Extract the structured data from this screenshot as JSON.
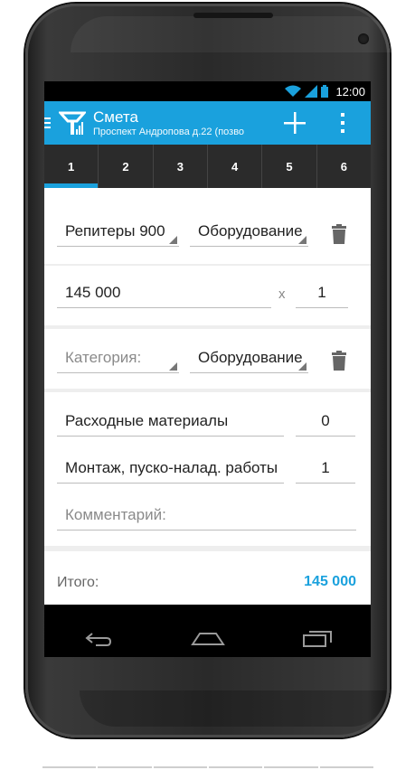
{
  "status_bar": {
    "time": "12:00",
    "icons": [
      "wifi-icon",
      "signal-icon",
      "battery-icon"
    ]
  },
  "action_bar": {
    "title": "Смета",
    "subtitle": "Проспект Андропова д.22 (позво",
    "icons": [
      "menu-icon",
      "app-logo-icon",
      "add-icon",
      "more-icon"
    ]
  },
  "tabs": [
    {
      "label": "1",
      "active": true
    },
    {
      "label": "2"
    },
    {
      "label": "3"
    },
    {
      "label": "4"
    },
    {
      "label": "5"
    },
    {
      "label": "6"
    }
  ],
  "item1": {
    "product": "Репитеры 900",
    "category": "Оборудование",
    "price": "145 000",
    "multiplier": "x",
    "quantity": "1"
  },
  "item2": {
    "product_placeholder": "Категория:",
    "category": "Оборудование"
  },
  "extras": [
    {
      "label": "Расходные материалы",
      "value": "0"
    },
    {
      "label": "Монтаж, пуско-налад. работы",
      "value": "1"
    }
  ],
  "comment_placeholder": "Комментарий:",
  "total": {
    "label": "Итого:",
    "value": "145 000"
  },
  "colors": {
    "accent": "#1aa1dd",
    "tabs_bg": "#2b2b2b"
  },
  "nav_icons": [
    "back-icon",
    "home-icon",
    "recents-icon"
  ]
}
